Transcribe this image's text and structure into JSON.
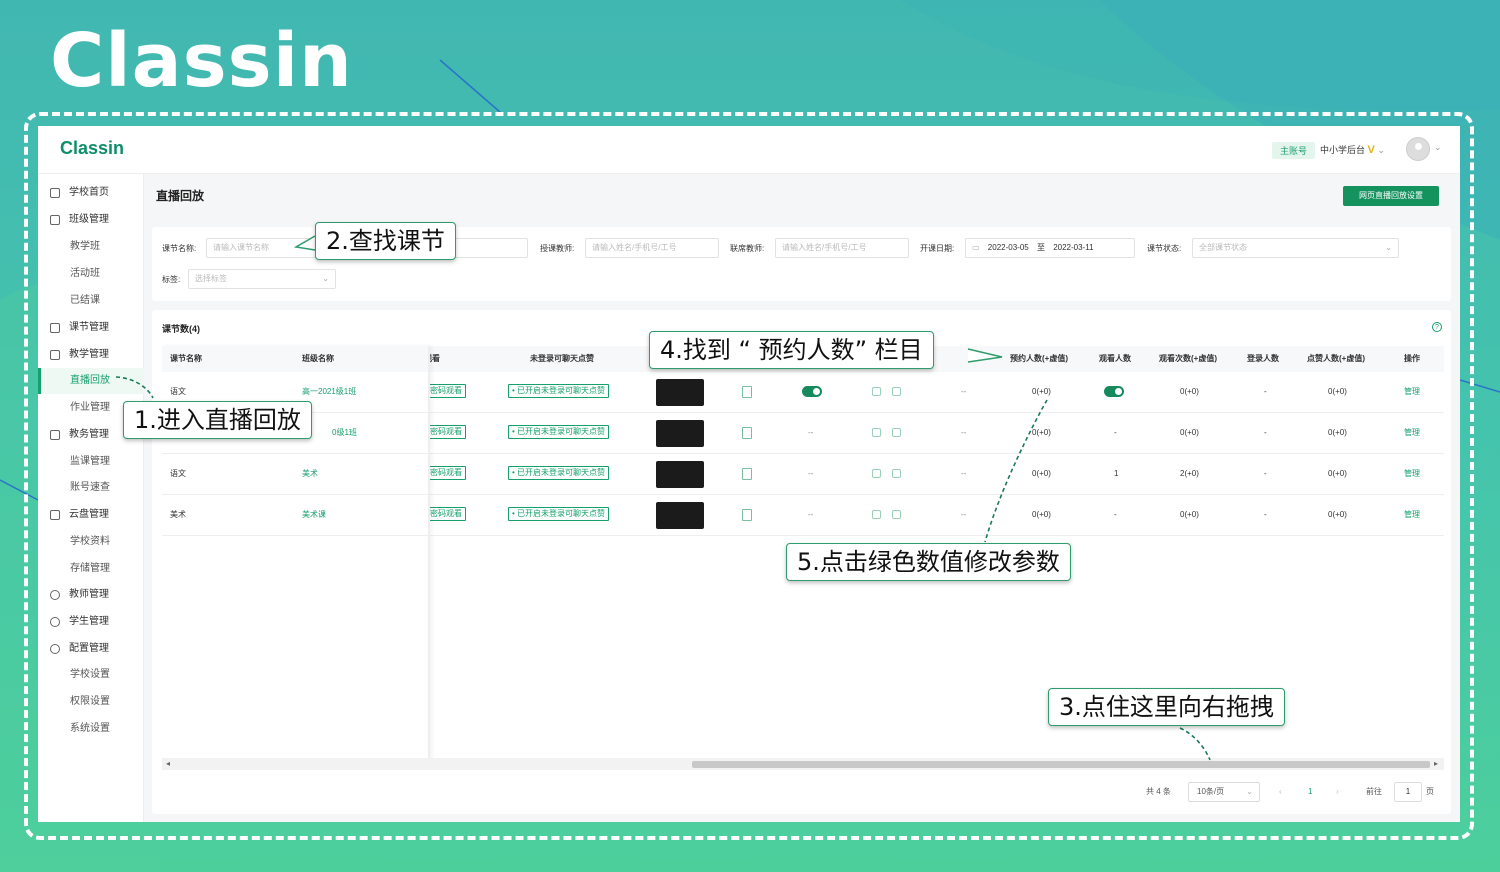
{
  "brand": "Classin",
  "app": {
    "logo": "Classin",
    "account_badge": "主账号",
    "school_name": "中小学后台",
    "vip_mark": "V"
  },
  "sidebar": {
    "items": [
      {
        "label": "学校首页",
        "icon": "home-icon"
      },
      {
        "label": "班级管理",
        "icon": "class-icon"
      },
      {
        "label": "教学班"
      },
      {
        "label": "活动班"
      },
      {
        "label": "已结课"
      },
      {
        "label": "课节管理",
        "icon": "lesson-icon"
      },
      {
        "label": "教学管理",
        "icon": "teaching-icon"
      },
      {
        "label": "直播回放",
        "active": true
      },
      {
        "label": "作业管理"
      },
      {
        "label": "教务管理",
        "icon": "affairs-icon"
      },
      {
        "label": "监课管理"
      },
      {
        "label": "账号速查"
      },
      {
        "label": "云盘管理",
        "icon": "cloud-icon"
      },
      {
        "label": "学校资料"
      },
      {
        "label": "存储管理"
      },
      {
        "label": "教师管理",
        "icon": "teacher-icon"
      },
      {
        "label": "学生管理",
        "icon": "student-icon"
      },
      {
        "label": "配置管理",
        "icon": "settings-icon"
      },
      {
        "label": "学校设置"
      },
      {
        "label": "权限设置"
      },
      {
        "label": "系统设置"
      }
    ]
  },
  "page": {
    "title": "直播回放",
    "settings_button": "网页直播回放设置"
  },
  "filters": {
    "lesson_name_label": "课节名称:",
    "lesson_name_placeholder": "请输入课节名称",
    "teacher_label": "授课教师:",
    "teacher_placeholder": "请输入姓名/手机号/工号",
    "co_teacher_label": "联席教师:",
    "co_teacher_placeholder": "请输入姓名/手机号/工号",
    "date_label": "开课日期:",
    "date_start": "2022-03-05",
    "date_sep": "至",
    "date_end": "2022-03-11",
    "status_label": "课节状态:",
    "status_placeholder": "全部课节状态",
    "tag_label": "标签:",
    "tag_placeholder": "选择标签"
  },
  "table": {
    "count_label": "课节数(4)",
    "headers": {
      "lesson": "课节名称",
      "class": "班级名称",
      "watch": "观看",
      "chat": "未登录可聊天点赞",
      "booked": "预约人数(+虚值)",
      "viewers": "观看人数",
      "views": "观看次数(+虚值)",
      "logins": "登录人数",
      "likes": "点赞人数(+虚值)",
      "action": "操作"
    },
    "rows": [
      {
        "lesson": "语文",
        "class": "高一2021级1班",
        "watch": "密码观看",
        "chat": "• 已开启未登录可聊天点赞",
        "toggle1": true,
        "dash": "--",
        "booked": "0(+0)",
        "viewers_toggle": true,
        "viewers": "",
        "views": "0(+0)",
        "logins": "-",
        "likes": "0(+0)",
        "action": "管理"
      },
      {
        "lesson": "",
        "class": "0级1班",
        "watch": "密码观看",
        "chat": "• 已开启未登录可聊天点赞",
        "toggle1": false,
        "col_toggle": "--",
        "dash": "--",
        "booked": "0(+0)",
        "viewers": "-",
        "views": "0(+0)",
        "logins": "-",
        "likes": "0(+0)",
        "action": "管理"
      },
      {
        "lesson": "语文",
        "class": "美术",
        "watch": "密码观看",
        "chat": "• 已开启未登录可聊天点赞",
        "toggle1": false,
        "col_toggle": "--",
        "dash": "--",
        "booked": "0(+0)",
        "viewers": "1",
        "views": "2(+0)",
        "logins": "-",
        "likes": "0(+0)",
        "action": "管理"
      },
      {
        "lesson": "美术",
        "class": "美术课",
        "watch": "密码观看",
        "chat": "• 已开启未登录可聊天点赞",
        "toggle1": false,
        "col_toggle": "--",
        "dash": "--",
        "booked": "0(+0)",
        "viewers": "-",
        "views": "0(+0)",
        "logins": "-",
        "likes": "0(+0)",
        "action": "管理"
      }
    ]
  },
  "pagination": {
    "total": "共 4 条",
    "page_size": "10条/页",
    "current": "1",
    "goto_label": "前往",
    "goto_value": "1",
    "page_unit": "页",
    "prev": "‹",
    "next": "›"
  },
  "callouts": {
    "step1": "1.进入直播回放",
    "step2": "2.查找课节",
    "step3": "3.点住这里向右拖拽",
    "step4": "4.找到 “ 预约人数” 栏目",
    "step5": "5.点击绿色数值修改参数"
  },
  "colors": {
    "accent": "#16a06c",
    "brand_bg": "#45c4ad"
  }
}
